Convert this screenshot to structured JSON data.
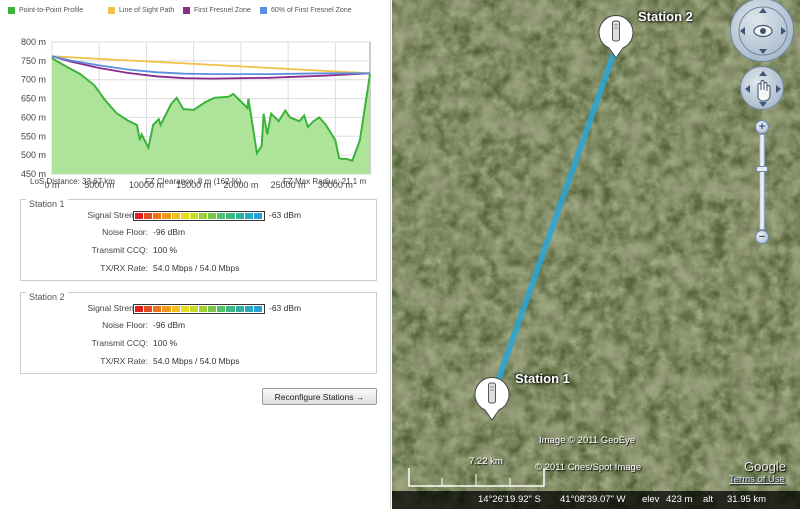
{
  "legend": [
    {
      "label": "Point-to-Point Profile",
      "color": "#3bb33b"
    },
    {
      "label": "Line of Sight Path",
      "color": "#f2c14a"
    },
    {
      "label": "First Fresnel Zone",
      "color": "#8a2a8a"
    },
    {
      "label": "60% of First Fresnel Zone",
      "color": "#5b8fe0"
    }
  ],
  "chart_data": {
    "type": "area",
    "xlabel": "",
    "ylabel": "",
    "xlim": [
      0,
      33670
    ],
    "ylim": [
      450,
      800
    ],
    "x_ticks": [
      "0 m",
      "5000 m",
      "10000 m",
      "15000 m",
      "20000 m",
      "25000 m",
      "30000 m"
    ],
    "y_ticks": [
      "450 m",
      "500 m",
      "550 m",
      "600 m",
      "650 m",
      "700 m",
      "750 m",
      "800 m"
    ],
    "grid": true,
    "series": [
      {
        "name": "Point-to-Point Profile",
        "color": "#3bb33b",
        "x": [
          0,
          1500,
          3000,
          4500,
          5500,
          6800,
          8000,
          9000,
          9300,
          9500,
          10200,
          10500,
          10700,
          11300,
          11500,
          12600,
          13200,
          13900,
          15000,
          16200,
          17200,
          18700,
          19200,
          20700,
          20800,
          21700,
          22200,
          22400,
          22800,
          23200,
          24000,
          24700,
          25200,
          26200,
          26700,
          27100,
          27700,
          28300,
          29000,
          30000,
          30400,
          30700,
          31200,
          31800,
          32600,
          33670
        ],
        "y": [
          757,
          735,
          715,
          685,
          650,
          612,
          592,
          580,
          540,
          555,
          520,
          555,
          580,
          595,
          580,
          635,
          652,
          622,
          620,
          640,
          652,
          655,
          662,
          625,
          650,
          505,
          525,
          610,
          555,
          610,
          590,
          618,
          600,
          590,
          605,
          575,
          590,
          600,
          580,
          540,
          492,
          490,
          490,
          485,
          540,
          715
        ]
      },
      {
        "name": "Line of Sight Path",
        "color": "#f2c14a",
        "x": [
          0,
          33670
        ],
        "y": [
          762,
          717
        ]
      },
      {
        "name": "First Fresnel Zone",
        "color": "#8a2a8a",
        "x": [
          0,
          2000,
          5000,
          8000,
          11000,
          14000,
          17000,
          20000,
          23000,
          26000,
          29000,
          31500,
          33670
        ],
        "y": [
          762,
          748,
          731,
          718,
          709,
          704,
          703,
          704,
          705,
          708,
          711,
          714,
          717
        ]
      },
      {
        "name": "60% of First Fresnel Zone",
        "color": "#5b8fe0",
        "x": [
          0,
          2000,
          5000,
          8000,
          11000,
          14000,
          17000,
          20000,
          23000,
          26000,
          29000,
          31500,
          33670
        ],
        "y": [
          762,
          751,
          738,
          727,
          720,
          716,
          715,
          715,
          715,
          716,
          717,
          717,
          717
        ]
      }
    ]
  },
  "footer": {
    "los_distance": "LoS Distance: 33.67 km",
    "fz_clearance": "FZ Clearance: 8 m (162 %)",
    "fz_max_radius": "FZ Max Radius: 21.1 m"
  },
  "stations": [
    {
      "title": "Station 1",
      "signal_label": "Signal Strength:",
      "signal_value": "-63 dBm",
      "signal_level": 1.0,
      "noise_label": "Noise Floor:",
      "noise_value": "-96 dBm",
      "ccq_label": "Transmit CCQ:",
      "ccq_value": "100 %",
      "rate_label": "TX/RX Rate:",
      "rate_value": "54.0 Mbps / 54.0 Mbps"
    },
    {
      "title": "Station 2",
      "signal_label": "Signal Strength:",
      "signal_value": "-63 dBm",
      "signal_level": 1.0,
      "noise_label": "Noise Floor:",
      "noise_value": "-96 dBm",
      "ccq_label": "Transmit CCQ:",
      "ccq_value": "100 %",
      "rate_label": "TX/RX Rate:",
      "rate_value": "54.0 Mbps / 54.0 Mbps"
    }
  ],
  "signal_colors": [
    "#e02020",
    "#e84a1c",
    "#f0741a",
    "#f29a1a",
    "#f2c01c",
    "#e6dc20",
    "#c6dc28",
    "#9ed232",
    "#76c846",
    "#56c064",
    "#3eb882",
    "#30b0a0",
    "#2aa8bc",
    "#28a0d4"
  ],
  "reconfigure_label": "Reconfigure Stations →",
  "map": {
    "station1_label": "Station 1",
    "station2_label": "Station 2",
    "link_color": "#2aa6d6",
    "imagery_credit": "Image © 2011 GeoEye",
    "cnes_credit": "© 2011 Cnes/Spot Image",
    "scale_label": "7.22 km",
    "google_logo": "Google",
    "terms_link": "Terms of Use",
    "lat": "14°26'19.92\" S",
    "lon": "41°08'39.07\" W",
    "elev_label": "elev",
    "elev_value": "423 m",
    "alt_label": "alt",
    "alt_value": "31.95 km",
    "zoom_in": "+",
    "zoom_out": "−",
    "zoom_level": 0.35
  }
}
